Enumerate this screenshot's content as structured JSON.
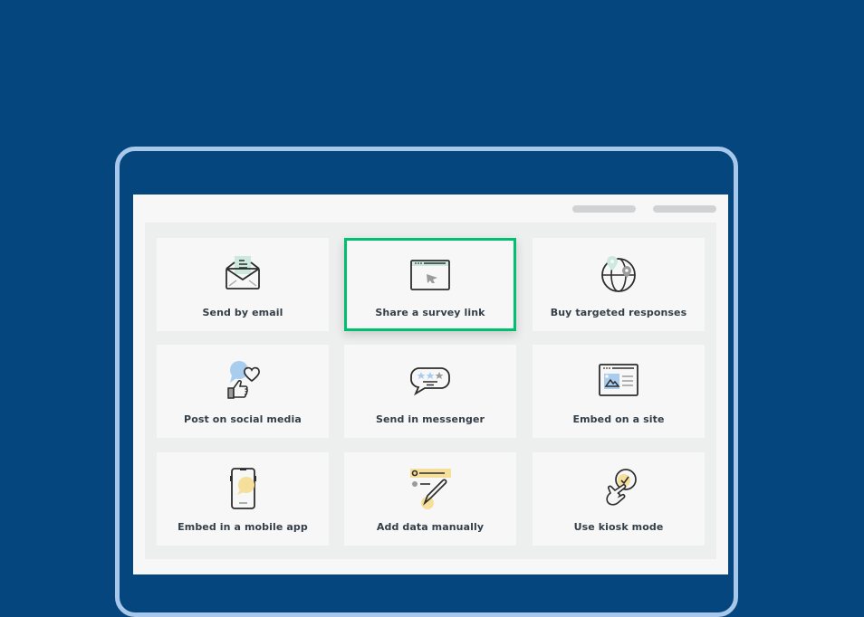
{
  "colors": {
    "background": "#05467e",
    "frame_border": "#a7c8ea",
    "selected_border": "#00bf6f"
  },
  "header": {
    "placeholders": [
      "placeholder-bar",
      "placeholder-bar"
    ]
  },
  "options": [
    {
      "label": "Send by email",
      "icon": "envelope-icon",
      "selected": false
    },
    {
      "label": "Share a survey link",
      "icon": "browser-cursor-icon",
      "selected": true
    },
    {
      "label": "Buy targeted responses",
      "icon": "globe-pin-icon",
      "selected": false
    },
    {
      "label": "Post on social media",
      "icon": "social-like-icon",
      "selected": false
    },
    {
      "label": "Send in messenger",
      "icon": "chat-bubble-stars-icon",
      "selected": false
    },
    {
      "label": "Embed on a site",
      "icon": "browser-image-icon",
      "selected": false
    },
    {
      "label": "Embed in a mobile app",
      "icon": "mobile-phone-icon",
      "selected": false
    },
    {
      "label": "Add data manually",
      "icon": "pencil-list-icon",
      "selected": false
    },
    {
      "label": "Use kiosk mode",
      "icon": "hand-tap-check-icon",
      "selected": false
    }
  ]
}
